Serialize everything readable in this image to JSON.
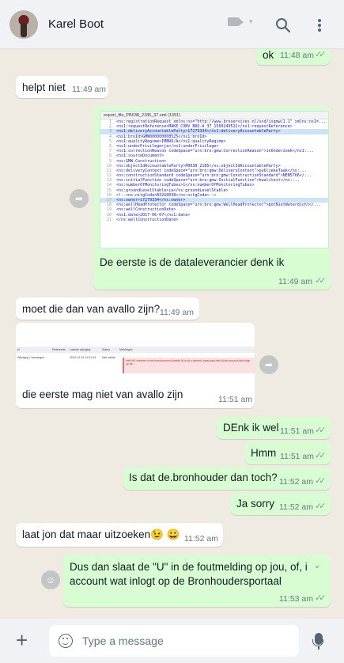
{
  "header": {
    "contact_name": "Karel Boot",
    "icons": [
      "video-call-icon",
      "search-icon",
      "menu-icon"
    ]
  },
  "messages": [
    {
      "dir": "out",
      "text": "ok",
      "time": "11:48 am",
      "status": "read"
    },
    {
      "dir": "in",
      "text": "helpt niet",
      "time": "11:49 am"
    },
    {
      "dir": "out",
      "type": "image",
      "caption": "De eerste is de dataleverancier denk ik",
      "time": "11:49 am",
      "status": "read",
      "image": {
        "tab": "export_file_PB038_2185_37.xml (1391)",
        "lines": [
          {
            "n": "1",
            "code": "<ns:registrationRequest xmlns:ns=\"http://www.broservices.nl/xsd/isgmw/1.1\" xmlns:ns1=...",
            "hl": false
          },
          {
            "n": "2",
            "code": "  <ns1:requestReference>MAKE_CONV_BRO-A_37_1560249522</ns1:requestReference>",
            "hl": false
          },
          {
            "n": "3",
            "code": "  <ns1:deliveryAccountableParty>17279334</ns1:deliveryAccountableParty>",
            "hl": true
          },
          {
            "n": "4",
            "code": "  <ns1:broId>GMW000000008525</ns1:broId>",
            "hl": false
          },
          {
            "n": "5",
            "code": "  <ns1:qualityRegime>IMBRO/A</ns1:qualityRegime>",
            "hl": false
          },
          {
            "n": "6",
            "code": "  <ns1:underPrivilege>ja</ns1:underPrivilege>",
            "hl": false
          },
          {
            "n": "7",
            "code": "  <ns1:correctionReason codeSpace=\"urn:bro:gmw:CorrectionReason\">inOnderzoek</ns1:...",
            "hl": false
          },
          {
            "n": "8",
            "code": "  <ns1:sourceDocument>",
            "hl": false
          },
          {
            "n": "9",
            "code": "    <ns:GMW_Construction>",
            "hl": false
          },
          {
            "n": "10",
            "code": "      <ns:objectIdAccountableParty>PB038_2185</ns:objectIdAccountableParty>",
            "hl": false
          },
          {
            "n": "11",
            "code": "      <ns:deliveryContext codeSpace=\"urn:bro:gmw:DeliveryContext\">publiekeTaak</ns:...",
            "hl": false
          },
          {
            "n": "12",
            "code": "      <ns:constructionStandard codeSpace=\"urn:bro:gmw:ConstructionStandard\">NEN5766</...",
            "hl": false
          },
          {
            "n": "13",
            "code": "      <ns:initialFunction codeSpace=\"urn:bro:gmw:InitialFunction\">kwaliteit</ns:...",
            "hl": false
          },
          {
            "n": "14",
            "code": "      <ns:numberOfMonitoringTubes>1</ns:numberOfMonitoringTubes>",
            "hl": false
          },
          {
            "n": "15",
            "code": "      <ns:groundLevelStable>ja</ns:groundLevelStable>",
            "hl": false
          },
          {
            "n": "16",
            "code": "      <!--<ns:nitgCode>B32G0038</ns:nitgCode>-->",
            "hl": false
          },
          {
            "n": "17",
            "code": "      <ns:owner>17279334</ns:owner>",
            "hl": true
          },
          {
            "n": "18",
            "code": "      <ns:wellHeadProtector codeSpace=\"urn:bro:gmw:WellHeadProtector\">potNietWaterdicht</...",
            "hl": false
          },
          {
            "n": "19",
            "code": "      <ns:wellConstructionDate>",
            "hl": false
          },
          {
            "n": "20",
            "code": "        <ns1:date>2017-06-07</ns1:date>",
            "hl": false
          },
          {
            "n": "21",
            "code": "      </ns:wellConstructionDate>",
            "hl": false
          }
        ]
      }
    },
    {
      "dir": "in",
      "text": "moet die dan van avallo zijn?",
      "time": "11:49 am"
    },
    {
      "dir": "in",
      "type": "image",
      "caption": "die eerste mag niet van avallo zijn",
      "time": "11:51 am",
      "image": {
        "headers": [
          "el",
          "Referentie",
          "Laatste wijziging",
          "Status",
          "Meldingen"
        ],
        "row": [
          "Wijziging / vervangen",
          "",
          "2024-12-19 11:51:04",
          "Niet valide",
          ""
        ],
        "error": "Het KvK-nummer in het brondocument (deelle A) is bij u bekend, maar past niet bij het account dat inlogt op de..."
      }
    },
    {
      "dir": "out",
      "text": "DEnk ik wel",
      "time": "11:51 am",
      "status": "read"
    },
    {
      "dir": "out",
      "text": "Hmm",
      "time": "11:51 am",
      "status": "read"
    },
    {
      "dir": "out",
      "text": "Is dat de.bronhouder dan toch?",
      "time": "11:52 am",
      "status": "read"
    },
    {
      "dir": "out",
      "text": "Ja sorry",
      "time": "11:52 am",
      "status": "read"
    },
    {
      "dir": "in",
      "text": "laat jon dat maar uitzoeken😉 😀",
      "time": "11:52 am"
    },
    {
      "dir": "out",
      "text_lines": [
        "Dus dan slaat de \"U\" in de foutmelding op jou, of, i",
        "account wat inlogt op de Bronhoudersportaal"
      ],
      "time": "11:53 am",
      "status": "read"
    }
  ],
  "composer": {
    "placeholder": "Type a message"
  },
  "colors": {
    "chat_bg": "#efeae2",
    "outgoing_bubble": "#d9fdd3",
    "incoming_bubble": "#ffffff",
    "header_bg": "#f0f2f5",
    "read_ticks": "#8696a0"
  }
}
